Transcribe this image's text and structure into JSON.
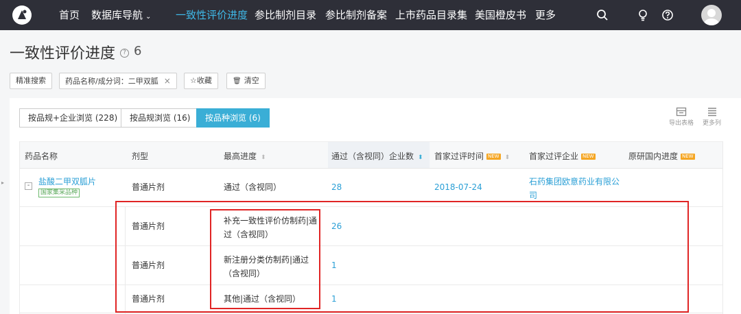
{
  "nav": {
    "items": [
      {
        "label": "首页",
        "active": false
      },
      {
        "label": "数据库导航",
        "active": false,
        "has_dropdown": true
      },
      {
        "label": "一致性评价进度",
        "active": true
      },
      {
        "label": "参比制剂目录",
        "active": false
      },
      {
        "label": "参比制剂备案",
        "active": false
      },
      {
        "label": "上市药品目录集",
        "active": false
      },
      {
        "label": "美国橙皮书",
        "active": false
      },
      {
        "label": "更多",
        "active": false
      }
    ],
    "dropdown_glyph": "⌄",
    "icons": [
      "search-icon",
      "bulb-icon",
      "help-icon",
      "user-avatar"
    ]
  },
  "page": {
    "title": "一致性评价进度",
    "help": "?",
    "count": "6"
  },
  "filters": {
    "precise_search": "精准搜索",
    "keyword_chip": "药品名称/成分词：二甲双胍",
    "remove_glyph": "×",
    "favorite": "☆收藏",
    "clear": "清空",
    "clear_icon": "🗑"
  },
  "view_tabs": [
    {
      "label": "按品规+企业浏览 (228)",
      "active": false
    },
    {
      "label": "按品规浏览 (16)",
      "active": false
    },
    {
      "label": "按品种浏览 (6)",
      "active": true
    }
  ],
  "tools": {
    "export": "导出表格",
    "more_cols": "更多列"
  },
  "table": {
    "columns": [
      "药品名称",
      "剂型",
      "最高进度",
      "通过（含视同）企业数",
      "首家过评时间",
      "首家过评企业",
      "原研国内进度"
    ],
    "new_badge": "NEW",
    "sort_glyph": "⬍",
    "rows": [
      {
        "drug": "盐酸二甲双胍片",
        "drug_tag": "国家集采品种",
        "expand": "-",
        "form": "普通片剂",
        "progress": "通过（含视同）",
        "count": "28",
        "first_date": "2018-07-24",
        "first_company_line1": "石药集团欧意药业有限公",
        "first_company_line2": "司"
      },
      {
        "form": "普通片剂",
        "progress_line1": "补充一致性评价仿制药|通",
        "progress_line2": "过（含视同）",
        "count": "26"
      },
      {
        "form": "普通片剂",
        "progress_line1": "新注册分类仿制药|通过",
        "progress_line2": "（含视同）",
        "count": "1"
      },
      {
        "form": "普通片剂",
        "progress": "其他|通过（含视同）",
        "count": "1"
      }
    ]
  },
  "colors": {
    "nav_bg": "#2e2f38",
    "accent": "#3aaed6",
    "link": "#2a9fd6",
    "highlight_box": "#e02424",
    "new_badge": "#f5a623"
  }
}
